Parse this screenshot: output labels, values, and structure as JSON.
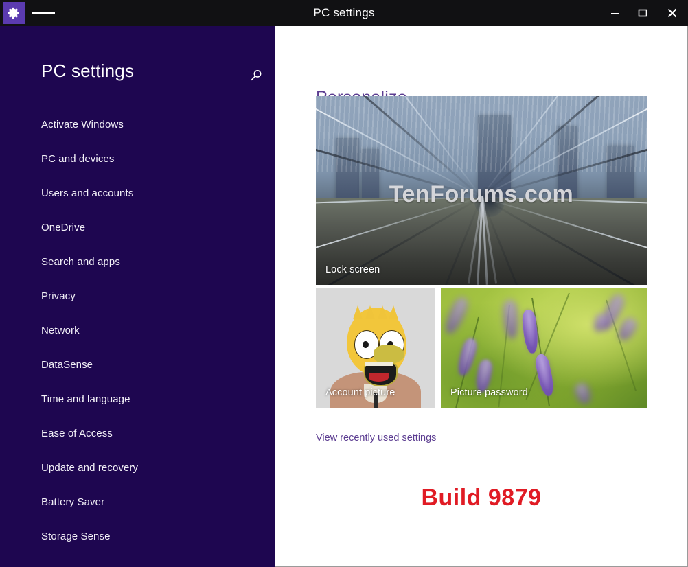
{
  "window": {
    "title": "PC settings",
    "app_icon": "gear-icon",
    "menu_icon": "hamburger-menu-icon",
    "controls": {
      "minimize": "minimize-icon",
      "maximize": "maximize-icon",
      "close": "close-icon"
    },
    "titlebar_color": "#111113"
  },
  "sidebar": {
    "title": "PC settings",
    "search_icon": "search-icon",
    "background_color": "#1E0650",
    "items": [
      {
        "label": "Activate Windows"
      },
      {
        "label": "PC and devices"
      },
      {
        "label": "Users and accounts"
      },
      {
        "label": "OneDrive"
      },
      {
        "label": "Search and apps"
      },
      {
        "label": "Privacy"
      },
      {
        "label": "Network"
      },
      {
        "label": "DataSense"
      },
      {
        "label": "Time and language"
      },
      {
        "label": "Ease of Access"
      },
      {
        "label": "Update and recovery"
      },
      {
        "label": "Battery Saver"
      },
      {
        "label": "Storage Sense"
      }
    ]
  },
  "main": {
    "page_title": "Personalize",
    "accent_color": "#5c3d91",
    "tiles": [
      {
        "label": "Lock screen",
        "watermark": "TenForums.com"
      },
      {
        "label": "Account picture"
      },
      {
        "label": "Picture password"
      }
    ],
    "recent_link": "View recently used settings",
    "build_text": "Build 9879",
    "build_color": "#e01b24"
  }
}
